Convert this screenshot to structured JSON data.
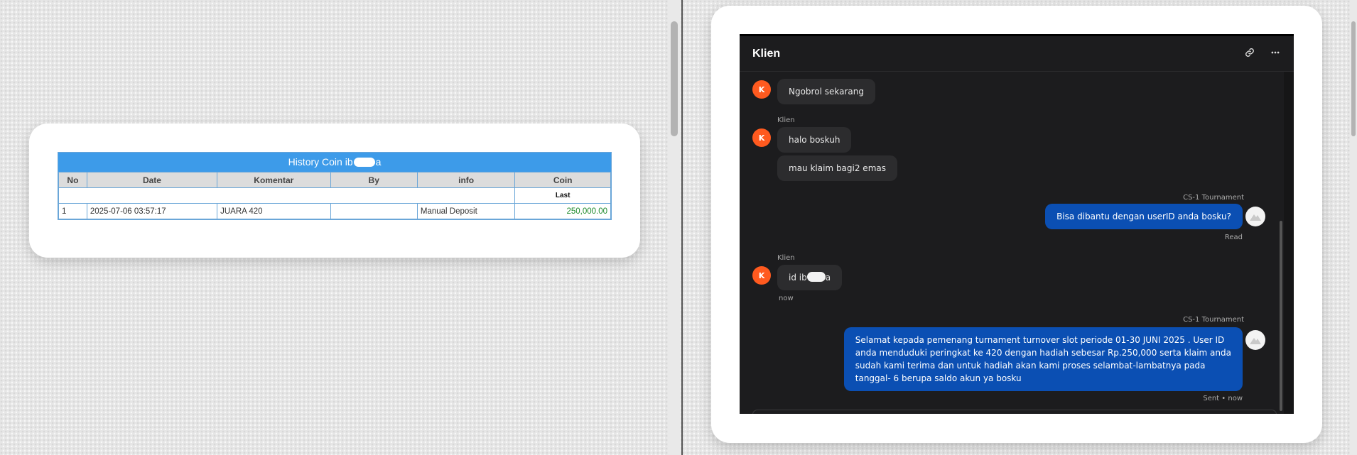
{
  "history": {
    "title_prefix": "History Coin ib",
    "title_suffix": "a",
    "columns": [
      "No",
      "Date",
      "Komentar",
      "By",
      "info",
      "Coin"
    ],
    "sub_label": "Last",
    "rows": [
      {
        "no": "1",
        "date": "2025-07-06 03:57:17",
        "komentar": "JUARA 420",
        "by": "",
        "info": "Manual Deposit",
        "coin": "250,000.00"
      }
    ]
  },
  "chat": {
    "title": "Klien",
    "avatar_letter": "K",
    "messages": [
      {
        "text": "Ngobrol sekarang"
      },
      {
        "sender": "Klien",
        "text": "halo boskuh"
      },
      {
        "text": "mau klaim bagi2 emas"
      },
      {
        "sender": "CS-1 Tournament",
        "text": "Bisa dibantu dengan userID anda bosku?",
        "status": "Read"
      },
      {
        "sender": "Klien",
        "text_prefix": "id ib",
        "text_suffix": "a",
        "status": "now"
      },
      {
        "sender": "CS-1 Tournament",
        "lines": [
          "Selamat kepada pemenang turnament turnover slot periode 01-30 JUNI 2025 . User ID",
          "anda menduduki peringkat ke 420 dengan hadiah sebesar Rp.250,000 serta klaim anda",
          "sudah kami terima dan untuk hadiah akan kami proses selambat-lambatnya pada",
          "tanggal- 6 berupa saldo akun ya bosku"
        ],
        "status": "Sent • now"
      }
    ]
  },
  "icons": {
    "link": "link-icon",
    "more": "more-icon",
    "agent": "agent-avatar-icon"
  },
  "colors": {
    "header_blue": "#3d9be9",
    "coin_green": "#1d8a2a",
    "avatar_orange": "#ff5a1f",
    "bubble_blue": "#0b4fb3",
    "chat_bg": "#1c1c1e"
  }
}
